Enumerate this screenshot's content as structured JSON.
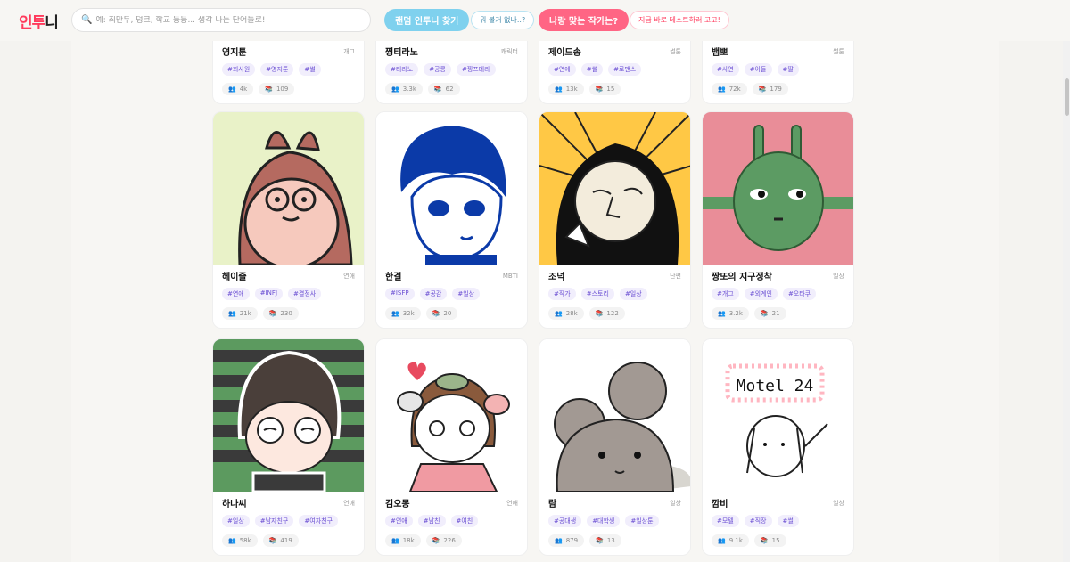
{
  "header": {
    "logo_part1": "인투",
    "logo_part2": "니",
    "search_placeholder": "예: 최만두, 덩크, 학교 등등... 생각 나는 단어들로!",
    "random_button": "랜덤 인투니 찾기",
    "random_bubble": "뭐 볼거 없나..?",
    "test_button": "나랑 맞는 작가는?",
    "test_bubble": "지금 바로 테스트하러 고고!"
  },
  "icons": {
    "search": "search-icon",
    "readers": "readers-icon",
    "episodes": "books-icon"
  },
  "cards": [
    {
      "name": "영지툰",
      "genre": "개그",
      "tags": [
        "#회사원",
        "#영지툰",
        "#썰"
      ],
      "readers": "4k",
      "episodes": "109"
    },
    {
      "name": "찡티라노",
      "genre": "캐릭터",
      "tags": [
        "#티라노",
        "#공룡",
        "#찡프테라"
      ],
      "readers": "3.3k",
      "episodes": "62"
    },
    {
      "name": "제이드송",
      "genre": "썰툰",
      "tags": [
        "#연애",
        "#썰",
        "#로맨스"
      ],
      "readers": "13k",
      "episodes": "15"
    },
    {
      "name": "뱀뽀",
      "genre": "썰툰",
      "tags": [
        "#사연",
        "#아들",
        "#딸"
      ],
      "readers": "72k",
      "episodes": "179"
    },
    {
      "name": "헤이즐",
      "genre": "연애",
      "tags": [
        "#연애",
        "#INFJ",
        "#결정사"
      ],
      "readers": "21k",
      "episodes": "230"
    },
    {
      "name": "한결",
      "genre": "MBTI",
      "tags": [
        "#ISFP",
        "#공감",
        "#일상"
      ],
      "readers": "32k",
      "episodes": "20"
    },
    {
      "name": "조넉",
      "genre": "단편",
      "tags": [
        "#작가",
        "#스토리",
        "#일상"
      ],
      "readers": "28k",
      "episodes": "122"
    },
    {
      "name": "짱또의 지구정착",
      "genre": "일상",
      "tags": [
        "#개그",
        "#외계인",
        "#오타쿠"
      ],
      "readers": "3.2k",
      "episodes": "21"
    },
    {
      "name": "하나씨",
      "genre": "연애",
      "tags": [
        "#일상",
        "#남자친구",
        "#여자친구"
      ],
      "readers": "58k",
      "episodes": "419"
    },
    {
      "name": "김오몽",
      "genre": "연애",
      "tags": [
        "#연애",
        "#남친",
        "#여친"
      ],
      "readers": "18k",
      "episodes": "226"
    },
    {
      "name": "람",
      "genre": "일상",
      "tags": [
        "#공대생",
        "#대학생",
        "#일상툰"
      ],
      "readers": "879",
      "episodes": "13"
    },
    {
      "name": "깜비",
      "genre": "일상",
      "tags": [
        "#모텔",
        "#직장",
        "#썰"
      ],
      "readers": "9.1k",
      "episodes": "15"
    }
  ],
  "artwork": {
    "motel_sign": "Motel 24"
  }
}
